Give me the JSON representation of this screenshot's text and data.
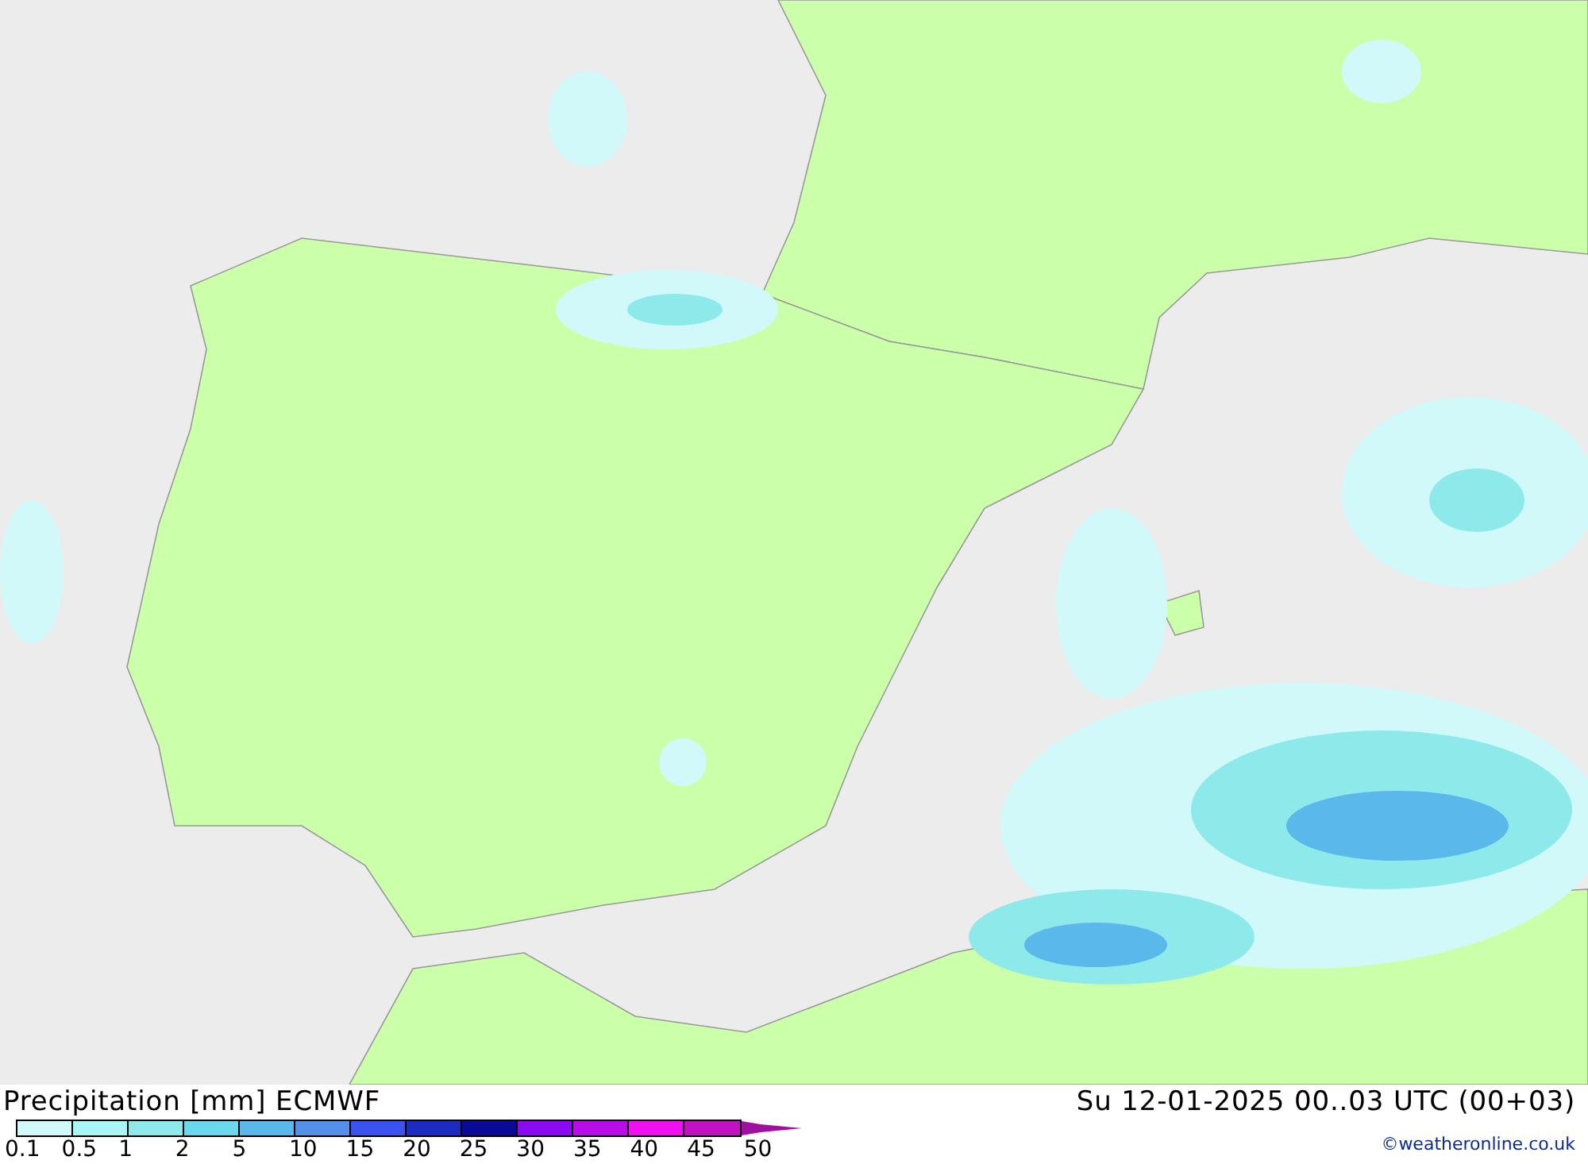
{
  "title": "Precipitation [mm] ECMWF",
  "valid_time": "Su 12-01-2025 00..03 UTC (00+03)",
  "credit": "©weatheronline.co.uk",
  "legend": {
    "swatches": [
      {
        "color": "#d2f9f9"
      },
      {
        "color": "#a8f7f7"
      },
      {
        "color": "#8eeaea"
      },
      {
        "color": "#6ad9ee"
      },
      {
        "color": "#5ab8ea"
      },
      {
        "color": "#5490e8"
      },
      {
        "color": "#3a52f0"
      },
      {
        "color": "#1c2cc0"
      },
      {
        "color": "#0a0a98"
      },
      {
        "color": "#8c0af2"
      },
      {
        "color": "#b80ce8"
      },
      {
        "color": "#f010f0"
      },
      {
        "color": "#c012c0"
      }
    ],
    "end_arrow": {
      "color": "#a010a0"
    },
    "ticks": [
      "0.1",
      "0.5",
      "1",
      "2",
      "5",
      "10",
      "15",
      "20",
      "25",
      "30",
      "35",
      "40",
      "45",
      "50"
    ]
  }
}
